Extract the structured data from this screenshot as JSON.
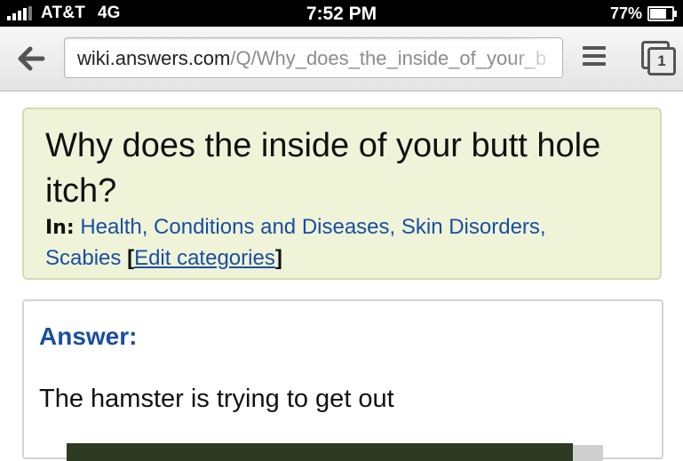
{
  "status_bar": {
    "carrier": "AT&T",
    "network": "4G",
    "time": "7:52 PM",
    "battery": "77%",
    "battery_level": 0.77
  },
  "browser": {
    "url_host": "wiki.answers.com",
    "url_path": "/Q/Why_does_the_inside_of_your_b",
    "tab_count": "1",
    "icons": [
      "back-arrow-icon",
      "menu-icon",
      "tabs-icon"
    ]
  },
  "question": {
    "title": "Why does the inside of your butt hole itch?",
    "categories_label": "In:",
    "categories_text": "Health, Conditions and Diseases, Skin Disorders, Scabies",
    "bracket_open": "[",
    "edit_categories": "Edit categories",
    "bracket_close": "]"
  },
  "answer": {
    "heading": "Answer:",
    "text": "The hamster is trying to get out"
  },
  "colors": {
    "link": "#1a4ea0",
    "question_bg": "#eff4d9",
    "status_bar_bg": "#000000"
  }
}
